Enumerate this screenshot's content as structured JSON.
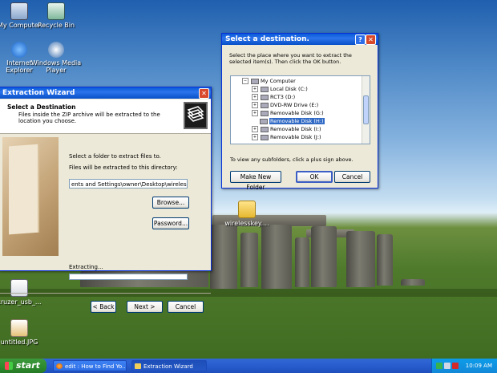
{
  "desktop": {
    "icons": [
      {
        "label": "My Computer",
        "icon": "my-computer-icon"
      },
      {
        "label": "Recycle Bin",
        "icon": "recycle-bin-icon"
      },
      {
        "label": "Internet Explorer",
        "icon": "internet-explorer-icon"
      },
      {
        "label": "Windows Media Player",
        "icon": "media-player-icon"
      },
      {
        "label": "wirelesskey....",
        "icon": "folder-icon"
      },
      {
        "label": "cruzer_usb_...",
        "icon": "image-file-icon"
      },
      {
        "label": "untitled.JPG",
        "icon": "image-file-icon"
      }
    ]
  },
  "wizard": {
    "title": "Extraction Wizard",
    "heading": "Select a Destination",
    "subheading": "Files inside the ZIP archive will be extracted to the location you choose.",
    "instruction": "Select a folder to extract files to.",
    "dir_label": "Files will be extracted to this directory:",
    "path_value": "ents and Settings\\owner\\Desktop\\wirelesskeyview",
    "browse_label": "Browse...",
    "password_label": "Password...",
    "extracting_label": "Extracting...",
    "progress": 0,
    "back_label": "< Back",
    "next_label": "Next >",
    "cancel_label": "Cancel"
  },
  "dest_dialog": {
    "title": "Select a destination.",
    "instruction": "Select the place where you want to extract the selected item(s).  Then click the OK button.",
    "tree": [
      {
        "label": "My Computer",
        "expander": "−",
        "selected": false
      },
      {
        "label": "Local Disk (C:)",
        "expander": "+",
        "selected": false
      },
      {
        "label": "RCT3 (D:)",
        "expander": "+",
        "selected": false
      },
      {
        "label": "DVD-RW Drive (E:)",
        "expander": "+",
        "selected": false
      },
      {
        "label": "Removable Disk (G:)",
        "expander": "+",
        "selected": false
      },
      {
        "label": "Removable Disk (H:)",
        "expander": "",
        "selected": true
      },
      {
        "label": "Removable Disk (I:)",
        "expander": "+",
        "selected": false
      },
      {
        "label": "Removable Disk (J:)",
        "expander": "+",
        "selected": false
      }
    ],
    "hint": "To view any subfolders, click a plus sign above.",
    "make_folder_label": "Make New Folder",
    "ok_label": "OK",
    "cancel_label": "Cancel"
  },
  "taskbar": {
    "start_label": "start",
    "tasks": [
      {
        "label": "edit : How to Find Yo...",
        "icon": "firefox-icon",
        "active": false
      },
      {
        "label": "Extraction Wizard",
        "icon": "folder-icon",
        "active": true
      }
    ],
    "clock": "10:09 AM"
  },
  "colors": {
    "title_blue": "#0a5ad8",
    "start_green": "#2f8d2f",
    "selection": "#316ac5"
  }
}
